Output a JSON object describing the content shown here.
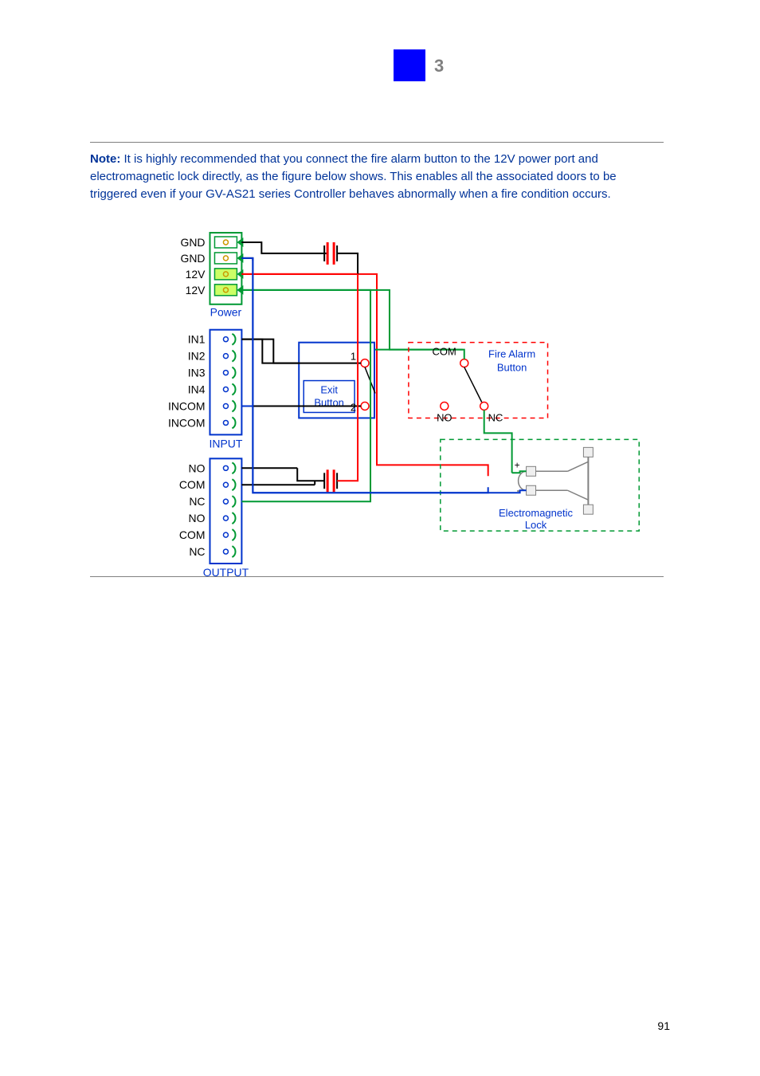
{
  "header": {
    "chapter": "3",
    "square_color": "#0000ff"
  },
  "note": {
    "label": "Note:",
    "body": " It is highly recommended that you connect the fire alarm button to the 12V power port and electromagnetic lock directly, as the figure below shows. This enables all the associated doors to be triggered even if your GV-AS21 series Controller behaves abnormally when a fire condition occurs."
  },
  "diagram": {
    "blocks": {
      "power": {
        "label": "Power",
        "pins": [
          "GND",
          "GND",
          "12V",
          "12V"
        ]
      },
      "input": {
        "label": "INPUT",
        "pins": [
          "IN1",
          "IN2",
          "IN3",
          "IN4",
          "INCOM",
          "INCOM"
        ]
      },
      "output": {
        "label": "OUTPUT",
        "pins": [
          "NO",
          "COM",
          "NC",
          "NO",
          "COM",
          "NC"
        ]
      }
    },
    "components": {
      "exit_button": {
        "label_top": "Exit",
        "label_bottom": "Button",
        "node1": "1",
        "node2": "2"
      },
      "fire_alarm": {
        "label_top": "Fire Alarm",
        "label_bottom": "Button",
        "com": "COM",
        "no": "NO",
        "nc": "NC"
      },
      "lock": {
        "label_top": "Electromagnetic",
        "label_bottom": "Lock",
        "plus": "+",
        "minus": "-"
      }
    }
  },
  "page_number": "91"
}
